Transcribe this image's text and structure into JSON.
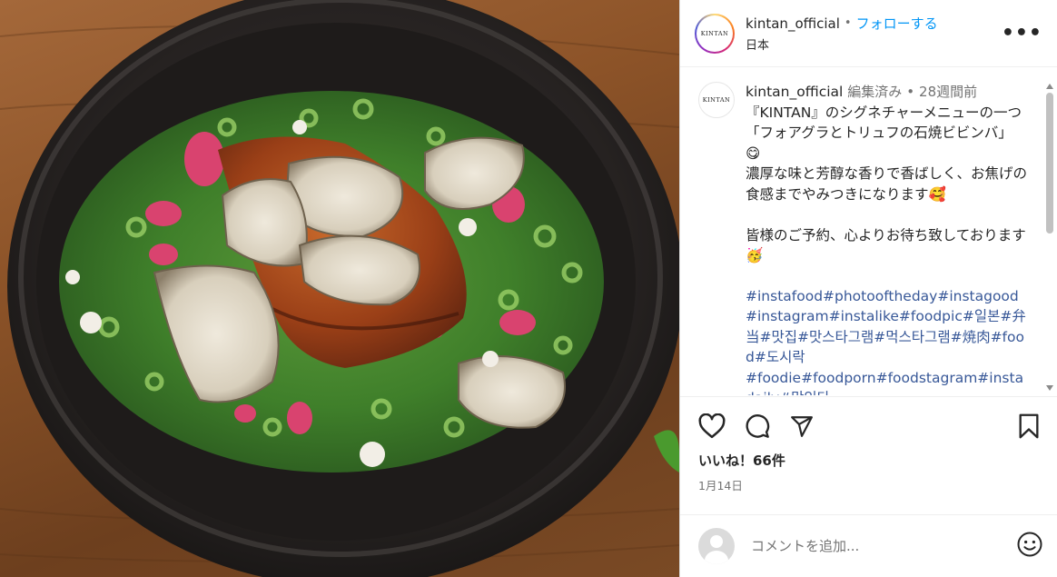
{
  "post": {
    "username": "kintan_official",
    "follow_label": "フォローする",
    "location": "日本",
    "logo_text": "KINTAN",
    "more_label": "•••"
  },
  "caption": {
    "username": "kintan_official",
    "edited_label": "編集済み",
    "time_ago": "28週間前",
    "text": "『KINTAN』のシグネチャーメニューの一つ「フォアグラとトリュフの石焼ビビンバ」 😋\n濃厚な味と芳醇な香りで香ばしく、お焦げの食感までやみつきになります🥰\n\n皆様のご予約、心よりお待ち致しております🥳",
    "hashtags": "#instafood#photooftheday#instagood#instagram#instalike#foodpic#일본#弁当#맛집#맛스타그램#먹스타그램#焼肉#food#도시락\n#foodie#foodporn#foodstagram#instadaily#맛있다"
  },
  "actions": {
    "like_icon": "heart-icon",
    "comment_icon": "comment-icon",
    "share_icon": "paper-plane-icon",
    "save_icon": "bookmark-icon",
    "likes_text": "いいね！66件",
    "date_text": "1月14日"
  },
  "comment_box": {
    "placeholder": "コメントを追加...",
    "emoji_icon": "smiley-icon"
  },
  "colors": {
    "follow_blue": "#0095f6",
    "hashtag_blue": "#385898",
    "muted_gray": "#737373"
  }
}
